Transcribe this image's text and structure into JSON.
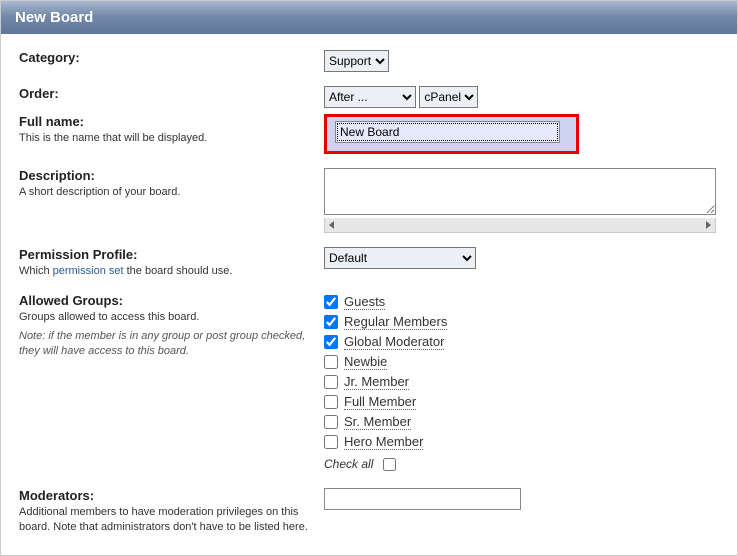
{
  "header": {
    "title": "New Board"
  },
  "category": {
    "label": "Category:",
    "value": "Support"
  },
  "order": {
    "label": "Order:",
    "value1": "After ...",
    "value2": "cPanel"
  },
  "fullname": {
    "label": "Full name:",
    "help": "This is the name that will be displayed.",
    "value": "New Board"
  },
  "description": {
    "label": "Description:",
    "help": "A short description of your board."
  },
  "permission": {
    "label": "Permission Profile:",
    "help_pre": "Which ",
    "help_link": "permission set",
    "help_post": " the board should use.",
    "value": "Default"
  },
  "groups": {
    "label": "Allowed Groups:",
    "help": "Groups allowed to access this board.",
    "note": "Note: if the member is in any group or post group checked, they will have access to this board.",
    "items": [
      {
        "label": "Guests",
        "checked": true
      },
      {
        "label": "Regular Members",
        "checked": true
      },
      {
        "label": "Global Moderator",
        "checked": true
      },
      {
        "label": "Newbie",
        "checked": false
      },
      {
        "label": "Jr. Member",
        "checked": false
      },
      {
        "label": "Full Member",
        "checked": false
      },
      {
        "label": "Sr. Member",
        "checked": false
      },
      {
        "label": "Hero Member",
        "checked": false
      }
    ],
    "check_all": "Check all"
  },
  "moderators": {
    "label": "Moderators:",
    "help": "Additional members to have moderation privileges on this board. Note that administrators don't have to be listed here."
  }
}
